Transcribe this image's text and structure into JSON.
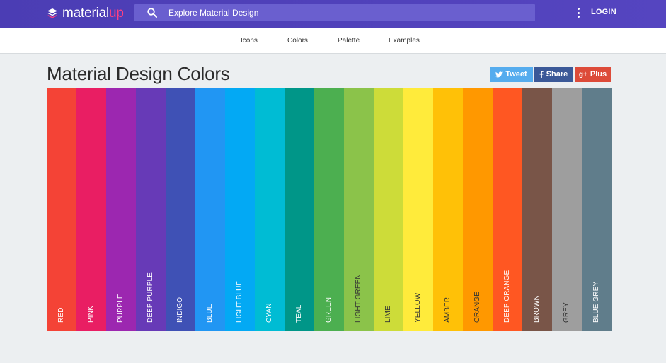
{
  "header": {
    "logo_text_main": "material",
    "logo_text_accent": "up",
    "search_placeholder": "Explore Material Design",
    "login_label": "LOGIN",
    "colors": {
      "bar": "#4b3db4",
      "accent": "#ff4081"
    }
  },
  "subnav": {
    "items": [
      {
        "label": "Icons"
      },
      {
        "label": "Colors"
      },
      {
        "label": "Palette"
      },
      {
        "label": "Examples"
      }
    ]
  },
  "page": {
    "title": "Material Design Colors"
  },
  "share": {
    "tweet_label": "Tweet",
    "share_label": "Share",
    "plus_label": "Plus",
    "colors": {
      "tweet": "#55acee",
      "share": "#3b5998",
      "plus": "#dd4b39"
    }
  },
  "palette": [
    {
      "name": "RED",
      "color": "#f44336",
      "dark_text": false
    },
    {
      "name": "PINK",
      "color": "#e91e63",
      "dark_text": false
    },
    {
      "name": "PURPLE",
      "color": "#9c27b0",
      "dark_text": false
    },
    {
      "name": "DEEP PURPLE",
      "color": "#673ab7",
      "dark_text": false
    },
    {
      "name": "INDIGO",
      "color": "#3f51b5",
      "dark_text": false
    },
    {
      "name": "BLUE",
      "color": "#2196f3",
      "dark_text": false
    },
    {
      "name": "LIGHT BLUE",
      "color": "#03a9f4",
      "dark_text": false
    },
    {
      "name": "CYAN",
      "color": "#00bcd4",
      "dark_text": false
    },
    {
      "name": "TEAL",
      "color": "#009688",
      "dark_text": false
    },
    {
      "name": "GREEN",
      "color": "#4caf50",
      "dark_text": false
    },
    {
      "name": "LIGHT GREEN",
      "color": "#8bc34a",
      "dark_text": true
    },
    {
      "name": "LIME",
      "color": "#cddc39",
      "dark_text": true
    },
    {
      "name": "YELLOW",
      "color": "#ffeb3b",
      "dark_text": true
    },
    {
      "name": "AMBER",
      "color": "#ffc107",
      "dark_text": true
    },
    {
      "name": "ORANGE",
      "color": "#ff9800",
      "dark_text": true
    },
    {
      "name": "DEEP ORANGE",
      "color": "#ff5722",
      "dark_text": false
    },
    {
      "name": "BROWN",
      "color": "#795548",
      "dark_text": false
    },
    {
      "name": "GREY",
      "color": "#9e9e9e",
      "dark_text": true
    },
    {
      "name": "BLUE GREY",
      "color": "#607d8b",
      "dark_text": false
    }
  ]
}
